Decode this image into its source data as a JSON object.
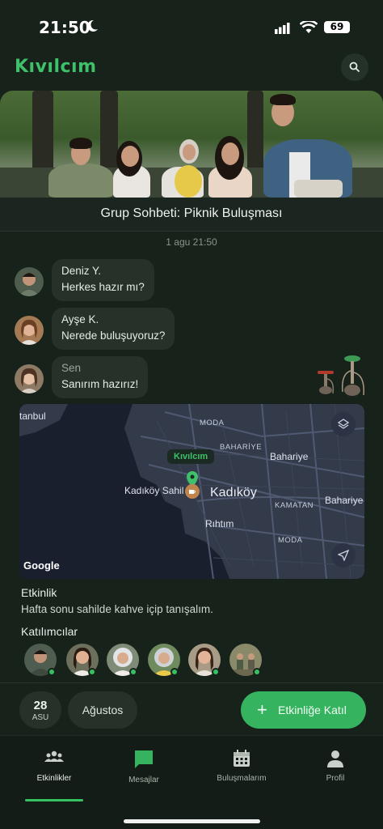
{
  "status_bar": {
    "time": "21:50",
    "battery": "69"
  },
  "app": {
    "brand": "Kıvılcım"
  },
  "chat": {
    "title": "Grup Sohbeti: Piknik Buluşması",
    "timestamp": "1 agu 21:50",
    "messages": [
      {
        "sender": "Deniz Y.",
        "text": "Herkes hazır mı?"
      },
      {
        "sender": "Ayşe K.",
        "text": "Nerede buluşuyoruz?"
      },
      {
        "sender": "Sen",
        "text": "Sanırım hazırız!"
      }
    ]
  },
  "map": {
    "labels": {
      "istanbul": "tanbul",
      "moda_top": "MODA",
      "bahariye_caps": "BAHARİYE",
      "bahariye1": "Bahariye",
      "bahariye2": "Bahariye",
      "kivilcim_pin": "Kıvılcım",
      "kadikoy_sahil": "Kadıköy Sahil",
      "kadikoy": "Kadıköy",
      "kamatan": "KAMATAN",
      "rihtim": "Rıhtım",
      "moda_bottom": "MODA",
      "google": "Google"
    },
    "accent": "#3fc06a"
  },
  "event": {
    "heading": "Etkinlik",
    "description": "Hafta sonu sahilde kahve içip tanışalım.",
    "participants_heading": "Katılımcılar"
  },
  "bottom_bar": {
    "date_day": "28",
    "date_month": "ASU",
    "month": "Ağustos",
    "join_label": "Etkinliğe Katıl"
  },
  "nav": {
    "items": [
      {
        "label": "Etkinlikler",
        "icon": "group-icon"
      },
      {
        "label": "Mesajlar",
        "icon": "chat-icon"
      },
      {
        "label": "Buluşmalarım",
        "icon": "calendar-icon"
      },
      {
        "label": "Profil",
        "icon": "person-icon"
      }
    ],
    "active": "Etkinlikler"
  },
  "colors": {
    "accent": "#35b35f",
    "background": "#17221b",
    "bubble": "#253129"
  }
}
